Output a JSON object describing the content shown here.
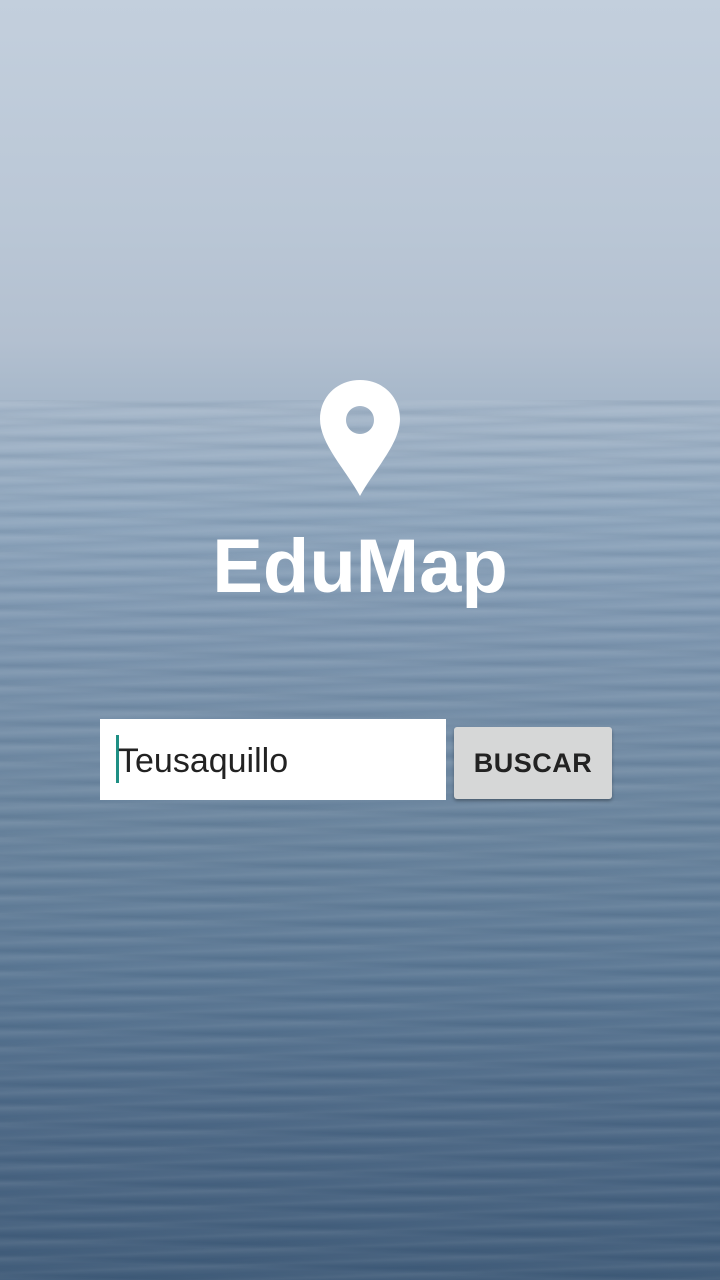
{
  "app": {
    "title": "EduMap",
    "logo_icon": "map-pin-icon"
  },
  "search": {
    "value": "Teusaquillo",
    "button_label": "BUSCAR"
  },
  "colors": {
    "caret": "#1e8f84",
    "button_bg": "#d6d7d7",
    "title": "#ffffff"
  }
}
